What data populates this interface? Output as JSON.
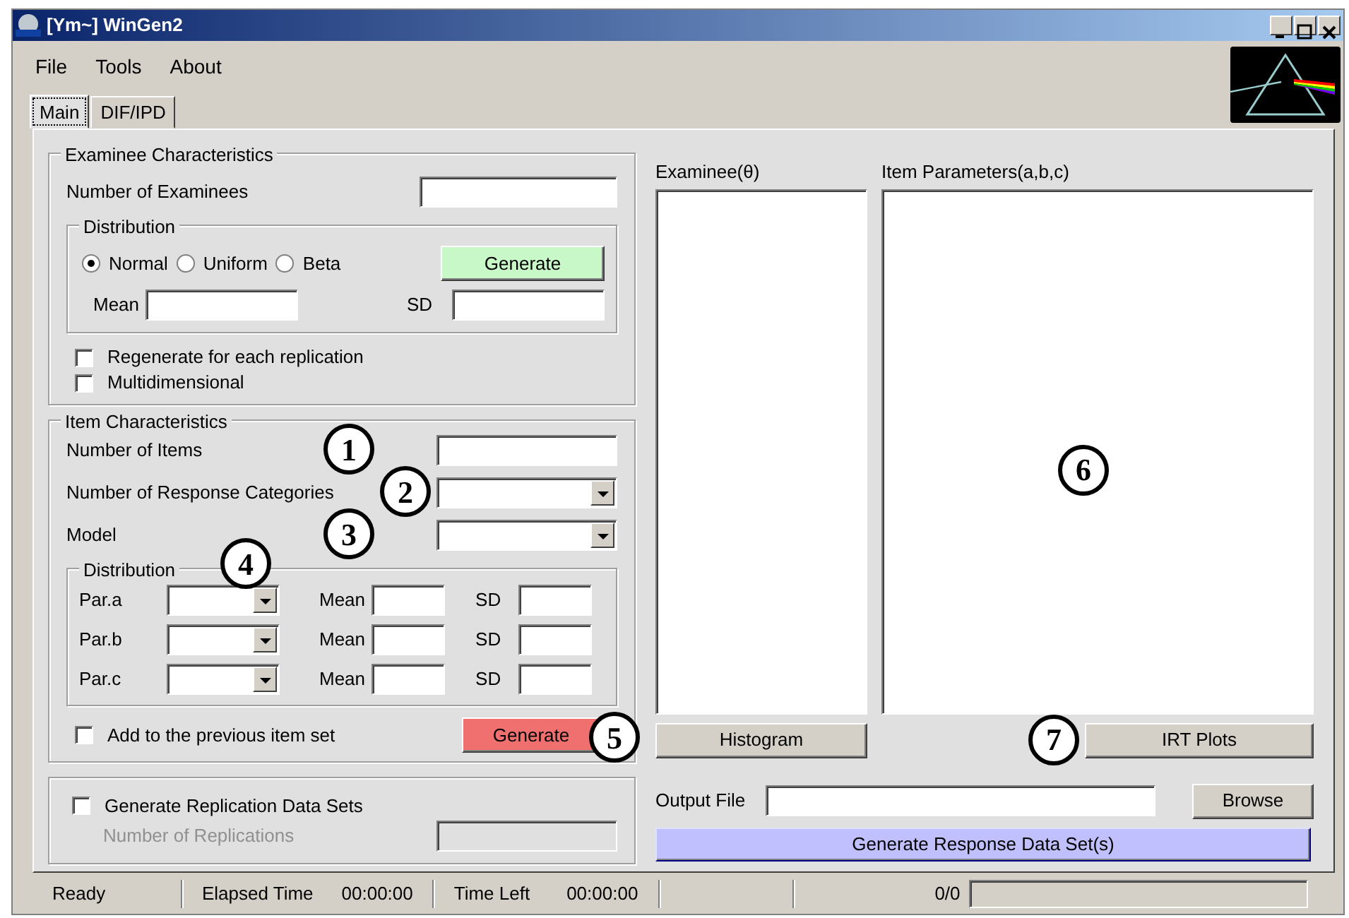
{
  "window": {
    "title": "[Ym~] WinGen2"
  },
  "menu": [
    {
      "label": "File"
    },
    {
      "label": "Tools"
    },
    {
      "label": "About"
    }
  ],
  "tabs": [
    {
      "label": "Main",
      "selected": true
    },
    {
      "label": "DIF/IPD",
      "selected": false
    }
  ],
  "examinee": {
    "title": "Examinee Characteristics",
    "count_label": "Number of Examinees",
    "distribution": {
      "title": "Distribution",
      "options": [
        {
          "label": "Normal",
          "selected": true
        },
        {
          "label": "Uniform",
          "selected": false
        },
        {
          "label": "Beta",
          "selected": false
        }
      ],
      "generate_button": "Generate",
      "mean_label": "Mean",
      "sd_label": "SD"
    },
    "checkboxes": [
      {
        "label": "Regenerate for each replication",
        "checked": false
      },
      {
        "label": "Multidimensional",
        "checked": false
      }
    ]
  },
  "items": {
    "title": "Item Characteristics",
    "fields": [
      {
        "label": "Number of Items",
        "kind": "text",
        "callout": "1"
      },
      {
        "label": "Number of Response Categories",
        "kind": "select",
        "callout": "2"
      },
      {
        "label": "Model",
        "kind": "select",
        "callout": "3"
      }
    ],
    "distribution": {
      "title": "Distribution",
      "callout": "4",
      "rows": [
        {
          "label": "Par.a",
          "mean_label": "Mean",
          "sd_label": "SD"
        },
        {
          "label": "Par.b",
          "mean_label": "Mean",
          "sd_label": "SD"
        },
        {
          "label": "Par.c",
          "mean_label": "Mean",
          "sd_label": "SD"
        }
      ]
    },
    "add_checkbox": {
      "label": "Add to the previous item set",
      "checked": false
    },
    "generate_button": {
      "label": "Generate",
      "callout": "5"
    }
  },
  "replication": {
    "checkbox": {
      "label": "Generate Replication Data Sets",
      "checked": false
    },
    "count_label": "Number of Replications",
    "disabled": true
  },
  "examinee_list": {
    "label": "Examinee(θ)"
  },
  "item_parameters": {
    "label": "Item Parameters(a,b,c)",
    "callout": "6"
  },
  "histogram_button": "Histogram",
  "irt_plots_button": {
    "label": "IRT Plots",
    "callout": "7"
  },
  "output": {
    "label": "Output File",
    "browse_button": "Browse"
  },
  "generate_response_button": "Generate Response Data Set(s)",
  "status_bar": {
    "status": "Ready",
    "elapsed_label": "Elapsed Time",
    "elapsed_value": "00:00:00",
    "left_label": "Time Left",
    "left_value": "00:00:00",
    "count": "0/0",
    "level": 0
  }
}
